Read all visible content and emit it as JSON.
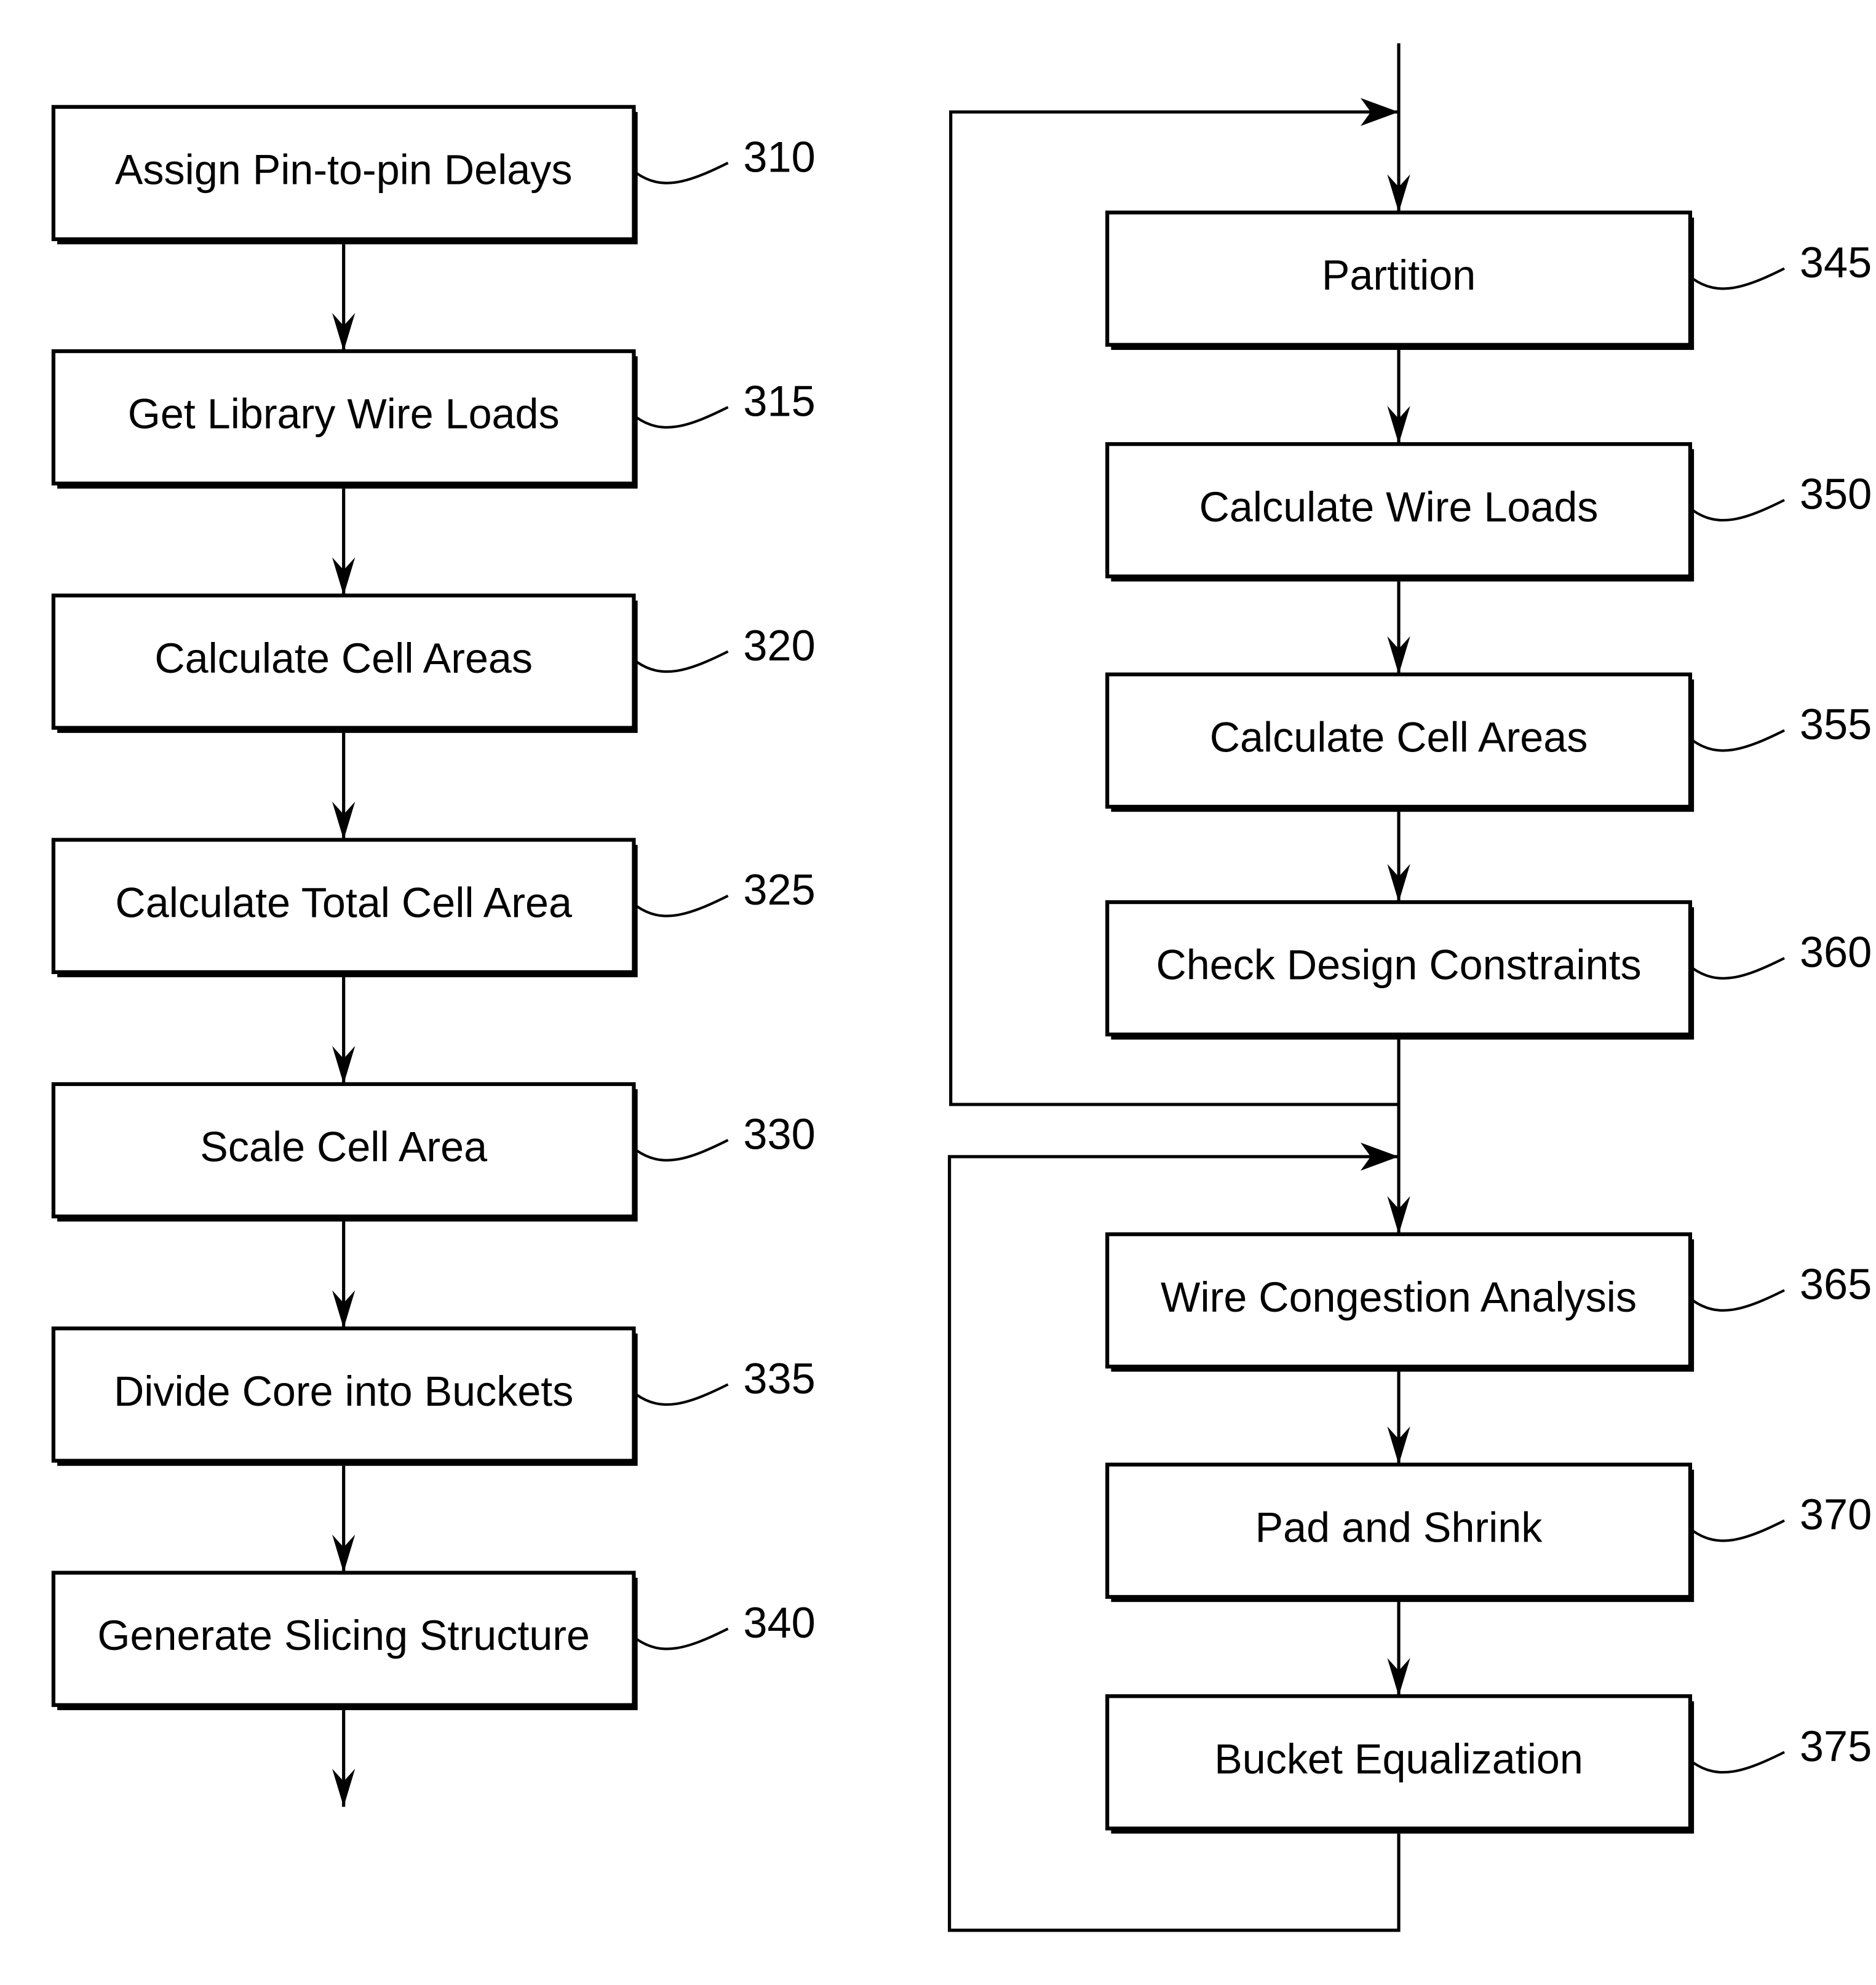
{
  "diagram": {
    "type": "flowchart",
    "left_column": {
      "steps": [
        {
          "ref": "310",
          "label": "Assign Pin-to-pin Delays"
        },
        {
          "ref": "315",
          "label": "Get Library Wire Loads"
        },
        {
          "ref": "320",
          "label": "Calculate Cell Areas"
        },
        {
          "ref": "325",
          "label": "Calculate Total Cell Area"
        },
        {
          "ref": "330",
          "label": "Scale Cell Area"
        },
        {
          "ref": "335",
          "label": "Divide Core into Buckets"
        },
        {
          "ref": "340",
          "label": "Generate Slicing Structure"
        }
      ]
    },
    "right_column": {
      "loop_1": {
        "steps": [
          {
            "ref": "345",
            "label": "Partition"
          },
          {
            "ref": "350",
            "label": "Calculate Wire Loads"
          },
          {
            "ref": "355",
            "label": "Calculate Cell Areas"
          },
          {
            "ref": "360",
            "label": "Check Design Constraints"
          }
        ]
      },
      "loop_2": {
        "steps": [
          {
            "ref": "365",
            "label": "Wire Congestion Analysis"
          },
          {
            "ref": "370",
            "label": "Pad and Shrink"
          },
          {
            "ref": "375",
            "label": "Bucket Equalization"
          }
        ]
      }
    }
  }
}
